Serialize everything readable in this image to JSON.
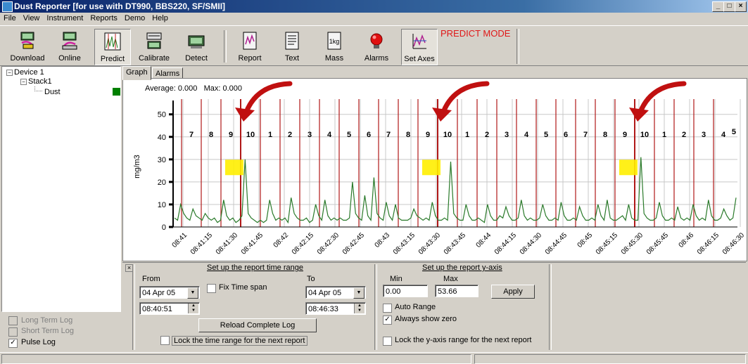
{
  "window": {
    "title": "Dust Reporter [for use with DT990, BBS220, SF/SMII]",
    "controls": [
      "_",
      "□",
      "×"
    ]
  },
  "menu": [
    "File",
    "View",
    "Instrument",
    "Reports",
    "Demo",
    "Help"
  ],
  "toolbar": {
    "buttons": [
      {
        "label": "Download",
        "icon": "download-icon",
        "pressed": false
      },
      {
        "label": "Online",
        "icon": "online-icon",
        "pressed": false
      },
      {
        "label": "Predict",
        "icon": "predict-icon",
        "pressed": true
      },
      {
        "label": "Calibrate",
        "icon": "calibrate-icon",
        "pressed": false
      },
      {
        "label": "Detect",
        "icon": "detect-icon",
        "pressed": false
      },
      {
        "label": "Report",
        "icon": "report-icon",
        "pressed": false
      },
      {
        "label": "Text",
        "icon": "text-icon",
        "pressed": false
      },
      {
        "label": "Mass",
        "icon": "mass-icon",
        "icon_text": "1kg",
        "pressed": false
      },
      {
        "label": "Alarms",
        "icon": "alarm-icon",
        "pressed": false
      },
      {
        "label": "Set Axes",
        "icon": "set-axes-icon",
        "pressed": true
      }
    ],
    "mode_text": "PREDICT MODE"
  },
  "tree": {
    "device": "Device 1",
    "stack": "Stack1",
    "sensor": "Dust",
    "expand_symbol": "−",
    "status_color": "#008000"
  },
  "logs": [
    {
      "label": "Long Term Log",
      "checked": false,
      "enabled": false
    },
    {
      "label": "Short Term Log",
      "checked": false,
      "enabled": false
    },
    {
      "label": "Pulse Log",
      "checked": true,
      "enabled": true
    }
  ],
  "tabs": [
    "Graph",
    "Alarms"
  ],
  "graph": {
    "average_label": "Average: 0.000",
    "max_label": "Max: 0.000"
  },
  "chart_data": {
    "type": "line",
    "ylabel": "mg/m3",
    "ylim": [
      0,
      53.66
    ],
    "yticks": [
      0,
      10,
      20,
      30,
      40,
      50
    ],
    "xticks": [
      "08:41",
      "08:41:15",
      "08:41:30",
      "08:41:45",
      "08:42",
      "08:42:15",
      "08:42:30",
      "08:42:45",
      "08:43",
      "08:43:15",
      "08:43:30",
      "08:43:45",
      "08:44",
      "08:44:15",
      "08:44:30",
      "08:44:45",
      "08:45",
      "08:45:15",
      "08:45:30",
      "08:45:45",
      "08:46",
      "08:46:15",
      "08:46:30"
    ],
    "pulse_labels": [
      "7",
      "8",
      "9",
      "10",
      "1",
      "2",
      "3",
      "4",
      "5",
      "6",
      "7",
      "8",
      "9",
      "10",
      "1",
      "2",
      "3",
      "4",
      "5",
      "6",
      "7",
      "8",
      "9",
      "10",
      "1",
      "2",
      "3",
      "4"
    ],
    "pulse_label_last": "5",
    "line_color": "#2a7a2a",
    "marker_color": "#b01818",
    "highlight_color": "#ffee00",
    "arrow_color": "#c01010",
    "series": [
      {
        "values": [
          4,
          3,
          10,
          6,
          4,
          3,
          8,
          5,
          4,
          3,
          6,
          4,
          3,
          4,
          2,
          3,
          12,
          5,
          3,
          4,
          2,
          3,
          5,
          30,
          6,
          4,
          3,
          2,
          3,
          2,
          3,
          12,
          6,
          3,
          4,
          3,
          4,
          2,
          13,
          6,
          4,
          3,
          3,
          4,
          2,
          3,
          10,
          5,
          3,
          12,
          5,
          3,
          4,
          3,
          4,
          3,
          3,
          4,
          20,
          6,
          4,
          3,
          14,
          5,
          3,
          22,
          6,
          4,
          3,
          11,
          5,
          3,
          10,
          4,
          3,
          3,
          3,
          4,
          8,
          5,
          4,
          3,
          4,
          3,
          11,
          5,
          3,
          3,
          4,
          3,
          29,
          6,
          4,
          3,
          3,
          10,
          5,
          3,
          3,
          4,
          3,
          2,
          10,
          5,
          3,
          3,
          5,
          4,
          9,
          5,
          3,
          3,
          4,
          12,
          5,
          3,
          4,
          3,
          3,
          4,
          10,
          5,
          3,
          3,
          4,
          3,
          11,
          5,
          3,
          3,
          4,
          3,
          9,
          5,
          3,
          3,
          4,
          3,
          10,
          5,
          3,
          12,
          4,
          3,
          3,
          4,
          5,
          3,
          10,
          4,
          3,
          3,
          31,
          6,
          4,
          3,
          3,
          4,
          11,
          5,
          3,
          3,
          4,
          3,
          9,
          4,
          3,
          4,
          3,
          10,
          5,
          3,
          4,
          3,
          12,
          5,
          3,
          3,
          4,
          8,
          5,
          3,
          4,
          13
        ]
      }
    ]
  },
  "time_range": {
    "title": "Set up the report time range",
    "from_label": "From",
    "to_label": "To",
    "from_date": "04 Apr 05",
    "from_time": "08:40:51",
    "to_date": "04 Apr 05",
    "to_time": "08:46:33",
    "fix_span_label": "Fix Time span",
    "reload_label": "Reload Complete Log",
    "lock_label": "Lock the time range for the next report"
  },
  "y_axis": {
    "title": "Set up the report y-axis",
    "min_label": "Min",
    "max_label": "Max",
    "min_value": "0.00",
    "max_value": "53.66",
    "apply_label": "Apply",
    "auto_range_label": "Auto Range",
    "always_zero_label": "Always show zero",
    "always_zero_checked": true,
    "lock_label": "Lock the  y-axis range for the next report"
  },
  "collapse_symbol": "×"
}
